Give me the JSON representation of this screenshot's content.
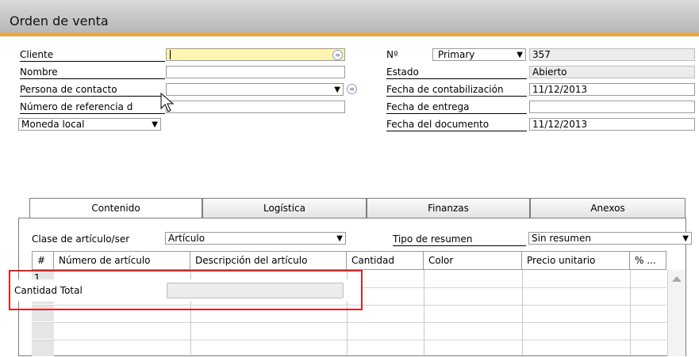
{
  "window": {
    "title": "Orden de venta"
  },
  "header_left": {
    "cliente_label": "Cliente",
    "nombre_label": "Nombre",
    "contacto_label": "Persona de contacto",
    "referencia_label": "Número de referencia d",
    "moneda_value": "Moneda local"
  },
  "header_right": {
    "no_label": "Nº",
    "series_value": "Primary",
    "number_value": "357",
    "estado_label": "Estado",
    "estado_value": "Abierto",
    "fecha_contab_label": "Fecha de contabilización",
    "fecha_contab_value": "11/12/2013",
    "fecha_entrega_label": "Fecha de entrega",
    "fecha_entrega_value": "",
    "fecha_doc_label": "Fecha del documento",
    "fecha_doc_value": "11/12/2013"
  },
  "tabs": [
    {
      "label": "Contenido"
    },
    {
      "label": "Logística"
    },
    {
      "label": "Finanzas"
    },
    {
      "label": "Anexos"
    }
  ],
  "content": {
    "clase_label": "Clase de artículo/ser",
    "clase_value": "Artículo",
    "resumen_label": "Tipo de resumen",
    "resumen_value": "Sin resumen"
  },
  "grid": {
    "columns": [
      "#",
      "Número de artículo",
      "Descripción del artículo",
      "Cantidad",
      "Color",
      "Precio unitario",
      "% ..."
    ],
    "first_row_num": "1"
  },
  "overlay": {
    "cantidad_total_label": "Cantidad Total",
    "cantidad_total_value": ""
  },
  "colors": {
    "accent": "#f0a431",
    "highlight": "#e32121",
    "required_field": "#fff4b0"
  }
}
